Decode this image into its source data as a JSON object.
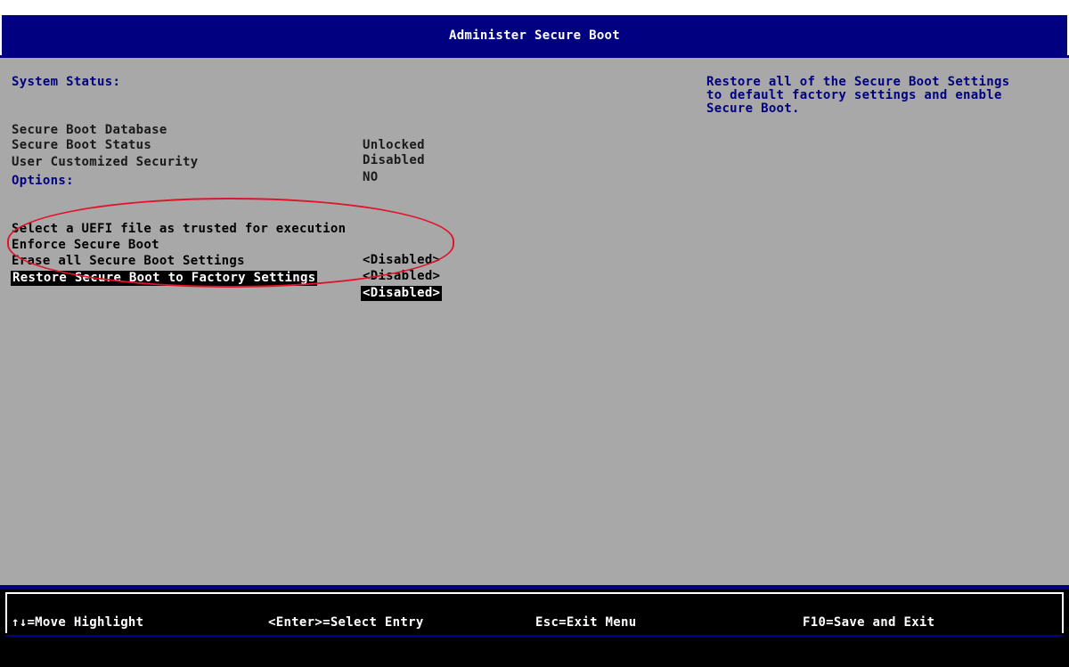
{
  "title": "Administer Secure Boot",
  "status_heading": "System Status:",
  "status_rows": [
    {
      "label": "Secure Boot Database",
      "value": "Unlocked"
    },
    {
      "label": "Secure Boot Status",
      "value": "Disabled"
    },
    {
      "label": "User Customized Security",
      "value": "NO"
    }
  ],
  "options_heading": "Options:",
  "options": [
    {
      "label": "Select a UEFI file as trusted for execution",
      "value": ""
    },
    {
      "label": "Enforce Secure Boot",
      "value": "<Disabled>"
    },
    {
      "label": "Erase all Secure Boot Settings",
      "value": "<Disabled>"
    },
    {
      "label": "Restore Secure Boot to Factory Settings",
      "value": "<Disabled>",
      "selected": true
    }
  ],
  "help_text": "Restore all of the Secure Boot Settings\nto default factory settings and enable\nSecure Boot.",
  "hints": [
    {
      "key": "move",
      "text": "↑↓=Move Highlight"
    },
    {
      "key": "enter",
      "text": "<Enter>=Select Entry"
    },
    {
      "key": "esc",
      "text": "Esc=Exit Menu"
    },
    {
      "key": "f10",
      "text": "F10=Save and Exit"
    }
  ],
  "colors": {
    "title_bar": "#000080",
    "background": "#a8a8a8",
    "heading_text": "#000080",
    "highlight_bg": "#000000",
    "annotation": "#e0142b"
  }
}
